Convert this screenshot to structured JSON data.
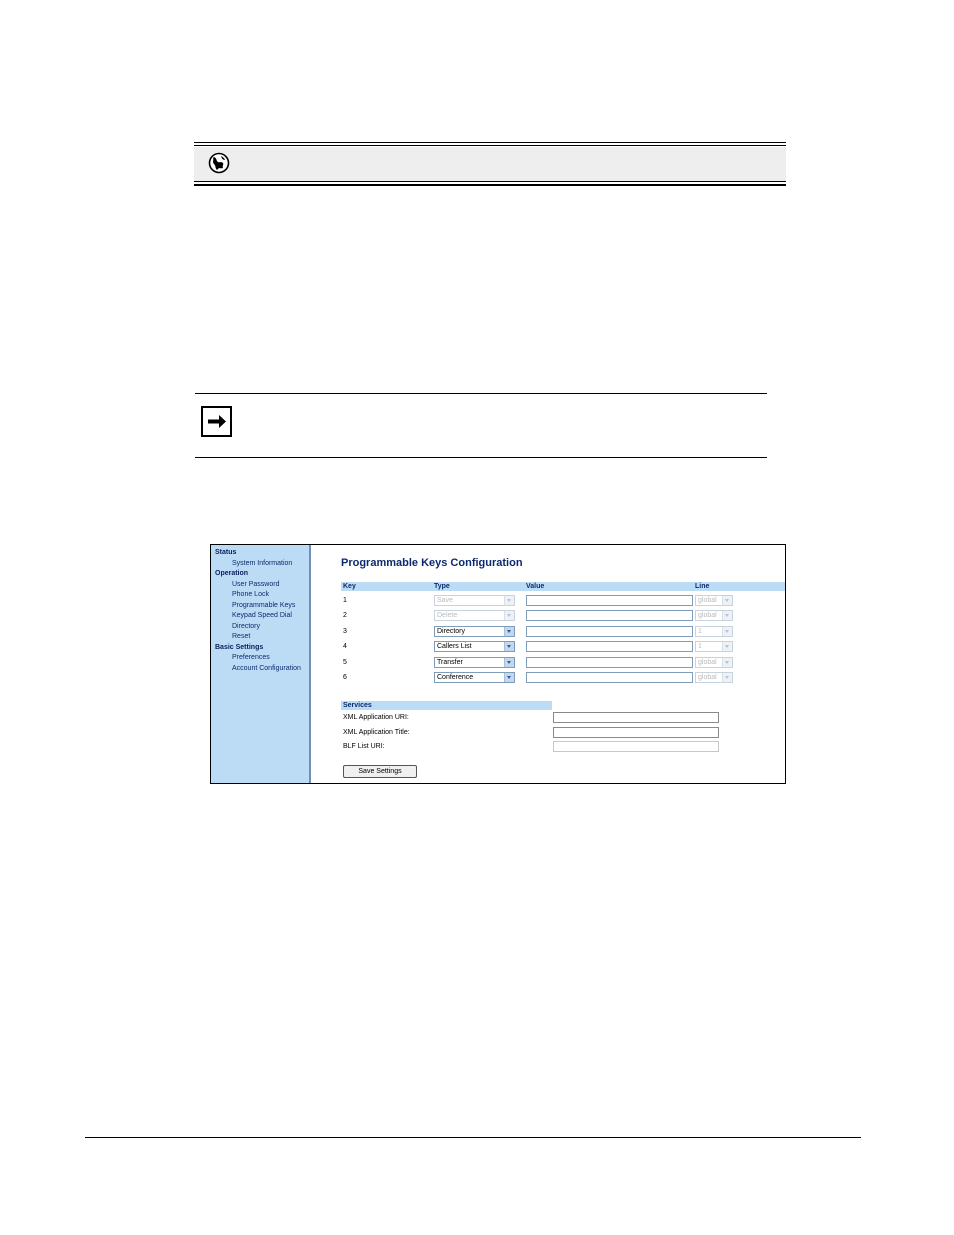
{
  "web_ui_note": {
    "icon": "globe-icon"
  },
  "note": {
    "icon": "arrow-right-icon"
  },
  "screenshot": {
    "sidebar": [
      {
        "label": "Status",
        "level": "head"
      },
      {
        "label": "System Information",
        "level": "sub"
      },
      {
        "label": "Operation",
        "level": "head"
      },
      {
        "label": "User Password",
        "level": "sub"
      },
      {
        "label": "Phone Lock",
        "level": "sub"
      },
      {
        "label": "Programmable Keys",
        "level": "sub"
      },
      {
        "label": "Keypad Speed Dial",
        "level": "sub"
      },
      {
        "label": "Directory",
        "level": "sub"
      },
      {
        "label": "Reset",
        "level": "sub"
      },
      {
        "label": "Basic Settings",
        "level": "head"
      },
      {
        "label": "Preferences",
        "level": "sub"
      },
      {
        "label": "Account Configuration",
        "level": "sub"
      }
    ],
    "title": "Programmable Keys Configuration",
    "columns": {
      "key": "Key",
      "type": "Type",
      "value": "Value",
      "line": "Line"
    },
    "rows": [
      {
        "key": "1",
        "type": "Save",
        "type_disabled": true,
        "value": "",
        "line": "global",
        "line_disabled": true
      },
      {
        "key": "2",
        "type": "Delete",
        "type_disabled": true,
        "value": "",
        "line": "global",
        "line_disabled": true
      },
      {
        "key": "3",
        "type": "Directory",
        "type_disabled": false,
        "value": "",
        "line": "1",
        "line_disabled": true
      },
      {
        "key": "4",
        "type": "Callers List",
        "type_disabled": false,
        "value": "",
        "line": "1",
        "line_disabled": true
      },
      {
        "key": "5",
        "type": "Transfer",
        "type_disabled": false,
        "value": "",
        "line": "global",
        "line_disabled": true
      },
      {
        "key": "6",
        "type": "Conference",
        "type_disabled": false,
        "value": "",
        "line": "global",
        "line_disabled": true
      }
    ],
    "services": {
      "header": "Services",
      "fields": [
        {
          "label": "XML Application URI:",
          "value": ""
        },
        {
          "label": "XML Application Title:",
          "value": ""
        },
        {
          "label": "BLF List URI:",
          "value": ""
        }
      ]
    },
    "save_button": "Save Settings"
  }
}
